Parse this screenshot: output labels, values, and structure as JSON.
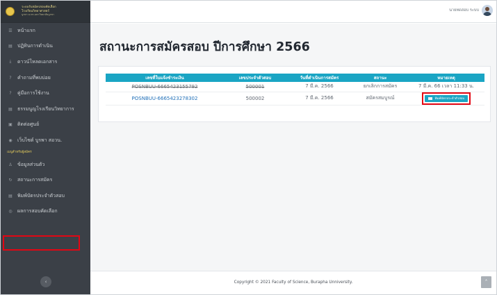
{
  "brand": {
    "line1": "ระบบรับสมัครสอบคัดเลือก",
    "line2": "โรงเรียนวิทยาศาสตร์",
    "line3": "บูรพา ม.ทร.มหาวิทยาลัยบูรพา"
  },
  "sidebar": {
    "items": [
      {
        "icon": "☰",
        "label": "หน้าแรก"
      },
      {
        "icon": "▤",
        "label": "ปฏิทินการดำเนิน"
      },
      {
        "icon": "⤓",
        "label": "ดาวน์โหลดเอกสาร"
      },
      {
        "icon": "?",
        "label": "คำถามที่พบบ่อย"
      },
      {
        "icon": "?",
        "label": "คู่มือการใช้งาน"
      },
      {
        "icon": "▤",
        "label": "ธรรมนูญโรงเรียนวิทยาการ"
      },
      {
        "icon": "▣",
        "label": "ติดต่อศูนย์"
      },
      {
        "icon": "◉",
        "label": "เว็บไซต์ บูรพา สอวน."
      }
    ],
    "section_label": "เมนูสำหรับผู้สมัคร",
    "user_items": [
      {
        "icon": "♙",
        "label": "ข้อมูลส่วนตัว"
      },
      {
        "icon": "↻",
        "label": "สถานะการสมัคร"
      },
      {
        "icon": "▤",
        "label": "พิมพ์บัตรประจำตัวสอบ"
      },
      {
        "icon": "◎",
        "label": "ผลการสอบคัดเลือก"
      }
    ],
    "collapse_icon": "‹"
  },
  "topbar": {
    "user_name": "นายทดสอบ ระบบ"
  },
  "main": {
    "title": "สถานะการสมัครสอบ ปีการศึกษา 2566",
    "table": {
      "headers": [
        "เลขที่ใบแจ้งชำระเงิน",
        "เลขประจำตัวสอบ",
        "วันที่ดำเนินการสมัคร",
        "สถานะ",
        "หมายเหตุ"
      ],
      "rows": [
        {
          "invoice": "POSNBUU-6665423155792",
          "exam_id": "500001",
          "date": "7 มี.ค. 2566",
          "status": "ยกเลิกการสมัคร",
          "note": "7 มี.ค. 66 เวลา 11:33 น."
        },
        {
          "invoice": "POSNBUU-6665423278302",
          "exam_id": "500002",
          "date": "7 มี.ค. 2566",
          "status": "สมัครสมบูรณ์",
          "note": "พิมพ์บัตรประจำตัวสอบ"
        }
      ]
    }
  },
  "footer": {
    "copyright": "Copyright © 2021 Faculty of Science, Burapha Unniversity.",
    "top_icon": "˄"
  }
}
